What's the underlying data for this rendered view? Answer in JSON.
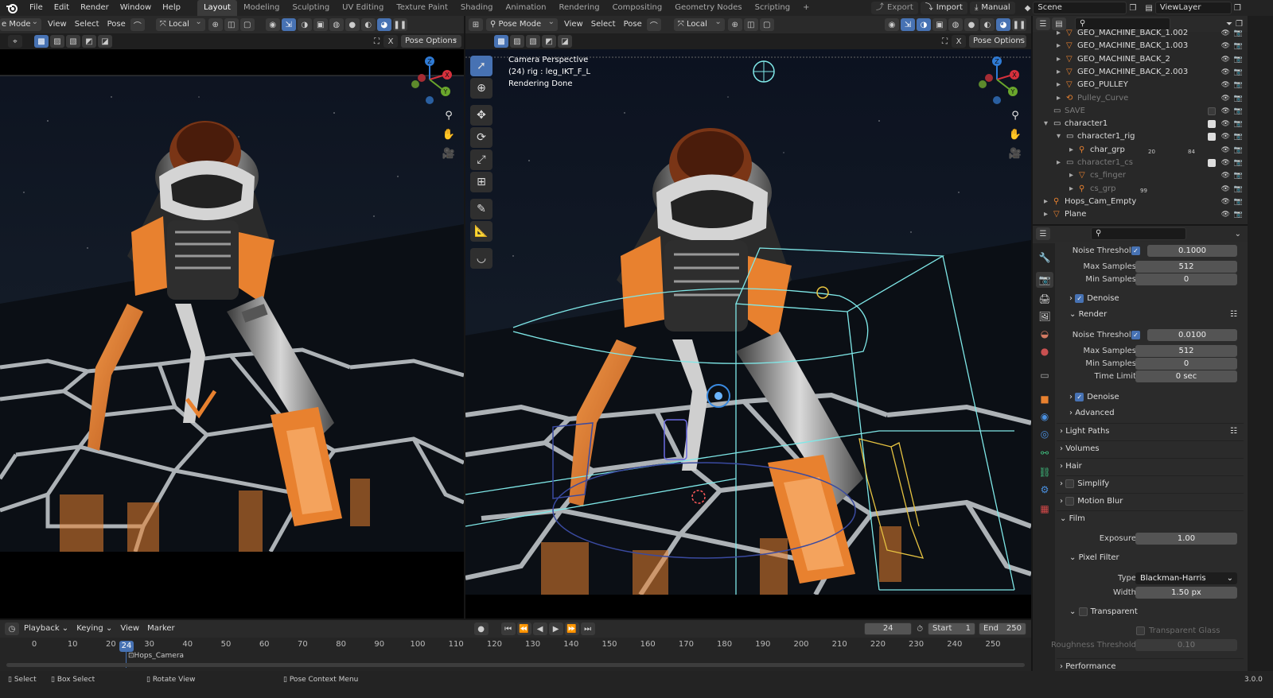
{
  "topbar": {
    "menus": [
      "File",
      "Edit",
      "Render",
      "Window",
      "Help"
    ],
    "workspaces": [
      "Layout",
      "Modeling",
      "Sculpting",
      "UV Editing",
      "Texture Paint",
      "Shading",
      "Animation",
      "Rendering",
      "Compositing",
      "Geometry Nodes",
      "Scripting"
    ],
    "active_workspace": "Layout",
    "add_tab": "+",
    "export_label": "Export",
    "import_label": "Import",
    "manual_label": "Manual",
    "scene_name": "Scene",
    "view_layer_name": "ViewLayer"
  },
  "left_viewport": {
    "mode": "e Mode",
    "menus": [
      "View",
      "Select",
      "Pose"
    ],
    "orientation": "Local",
    "pose_options": "Pose Options"
  },
  "right_viewport": {
    "mode": "Pose Mode",
    "menus": [
      "View",
      "Select",
      "Pose"
    ],
    "orientation": "Local",
    "pose_options": "Pose Options",
    "overlay_line1": "Camera Perspective",
    "overlay_line2": "(24) rig : leg_IKT_F_L",
    "overlay_line3": "Rendering Done"
  },
  "gizmo": {
    "z": "Z",
    "x": "X",
    "y": "Y"
  },
  "outliner": {
    "rows": [
      {
        "label": "GEO_MACHINE_BACK_1.002",
        "indent": 2,
        "dim": false
      },
      {
        "label": "GEO_MACHINE_BACK_1.003",
        "indent": 2,
        "dim": false
      },
      {
        "label": "GEO_MACHINE_BACK_2",
        "indent": 2,
        "dim": false
      },
      {
        "label": "GEO_MACHINE_BACK_2.003",
        "indent": 2,
        "dim": false
      },
      {
        "label": "GEO_PULLEY",
        "indent": 2,
        "dim": false
      },
      {
        "label": "Pulley_Curve",
        "indent": 2,
        "dim": true
      },
      {
        "label": "SAVE",
        "indent": 1,
        "dim": true
      },
      {
        "label": "character1",
        "indent": 1,
        "dim": false
      },
      {
        "label": "character1_rig",
        "indent": 2,
        "dim": false
      },
      {
        "label": "char_grp",
        "indent": 3,
        "dim": false
      },
      {
        "label": "character1_cs",
        "indent": 2,
        "dim": true
      },
      {
        "label": "cs_finger",
        "indent": 3,
        "dim": true
      },
      {
        "label": "cs_grp",
        "indent": 3,
        "dim": true
      },
      {
        "label": "Hops_Cam_Empty",
        "indent": 1,
        "dim": false
      },
      {
        "label": "Plane",
        "indent": 1,
        "dim": false
      }
    ],
    "badge_20": "20",
    "badge_84": "84",
    "badge_99": "99"
  },
  "properties": {
    "viewport_noise_threshold_label": "Noise Threshold",
    "viewport_noise_threshold": "0.1000",
    "viewport_max_samples_label": "Max Samples",
    "viewport_max_samples": "512",
    "viewport_min_samples_label": "Min Samples",
    "viewport_min_samples": "0",
    "denoise_label": "Denoise",
    "render_label": "Render",
    "render_noise_threshold_label": "Noise Threshold",
    "render_noise_threshold": "0.0100",
    "render_max_samples_label": "Max Samples",
    "render_max_samples": "512",
    "render_min_samples_label": "Min Samples",
    "render_min_samples": "0",
    "time_limit_label": "Time Limit",
    "time_limit": "0 sec",
    "render_denoise_label": "Denoise",
    "advanced_label": "Advanced",
    "light_paths_label": "Light Paths",
    "volumes_label": "Volumes",
    "hair_label": "Hair",
    "simplify_label": "Simplify",
    "motion_blur_label": "Motion Blur",
    "film_label": "Film",
    "exposure_label": "Exposure",
    "exposure": "1.00",
    "pixel_filter_label": "Pixel Filter",
    "type_label": "Type",
    "type_value": "Blackman-Harris",
    "width_label": "Width",
    "width_value": "1.50 px",
    "transparent_label": "Transparent",
    "transparent_glass_label": "Transparent Glass",
    "roughness_threshold_label": "Roughness Threshold",
    "roughness_threshold": "0.10",
    "performance_label": "Performance"
  },
  "timeline": {
    "menus": [
      "Playback",
      "Keying",
      "View",
      "Marker"
    ],
    "current_frame": "24",
    "start_label": "Start",
    "start": "1",
    "end_label": "End",
    "end": "250",
    "ticks": [
      "0",
      "10",
      "20",
      "30",
      "40",
      "50",
      "60",
      "70",
      "80",
      "90",
      "100",
      "110",
      "120",
      "130",
      "140",
      "150",
      "160",
      "170",
      "180",
      "190",
      "200",
      "210",
      "220",
      "230",
      "240",
      "250"
    ],
    "marker_label": "Hops_Camera"
  },
  "statusbar": {
    "select": "Select",
    "box_select": "Box Select",
    "rotate_view": "Rotate View",
    "pose_context_menu": "Pose Context Menu",
    "version": "3.0.0"
  },
  "colors": {
    "accent": "#4772b3",
    "robot_orange": "#e8812f",
    "wire": "#7fe8e8"
  }
}
